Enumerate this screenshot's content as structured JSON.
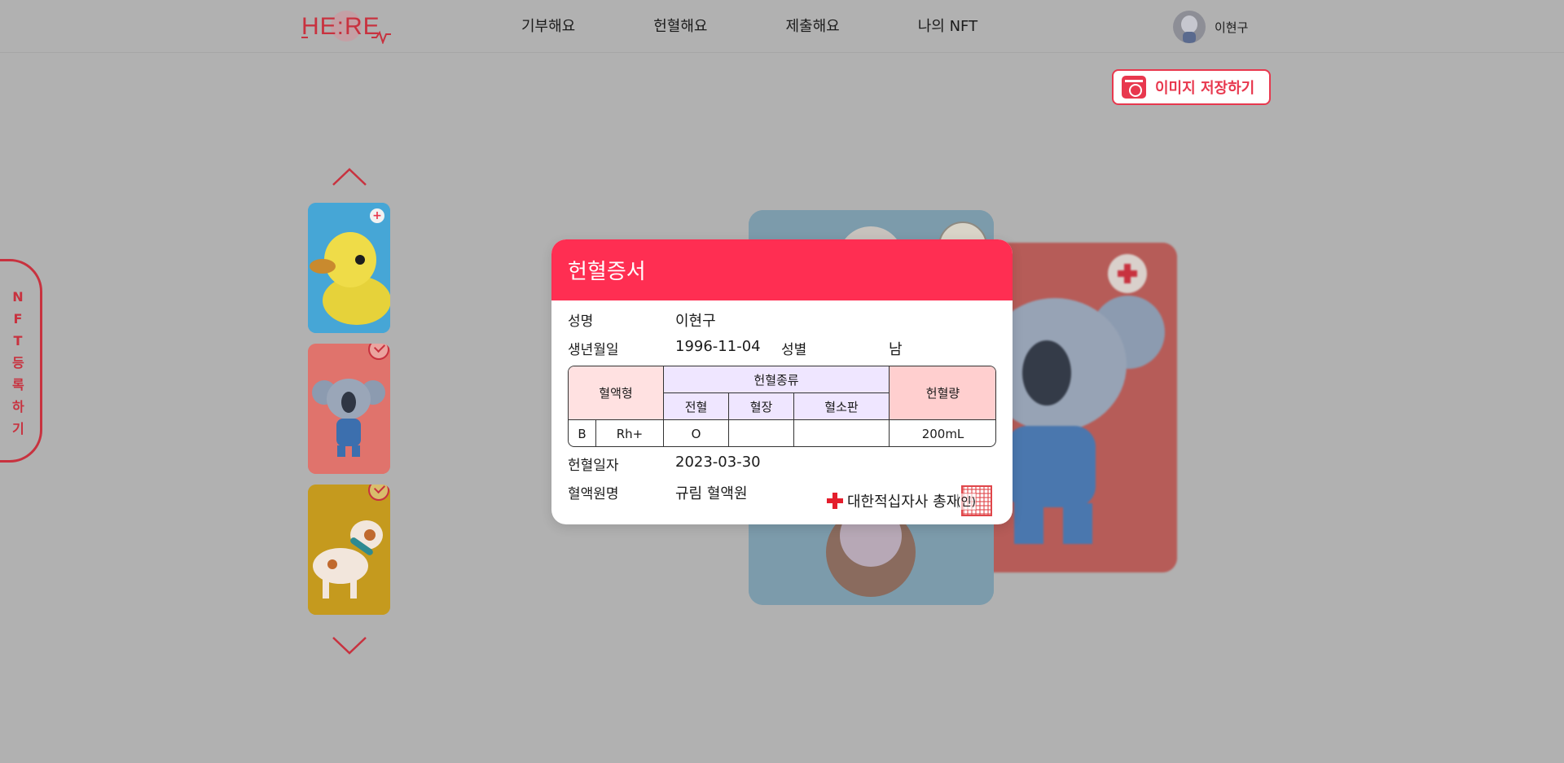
{
  "header": {
    "logo_text": "HE:RE",
    "nav": [
      "기부해요",
      "헌혈해요",
      "제출해요",
      "나의 NFT"
    ],
    "user_name": "이현구"
  },
  "actions": {
    "save_image_label": "이미지 저장하기"
  },
  "side_tab": {
    "label": "NFT등록하기"
  },
  "carousel": {
    "items": [
      {
        "name": "duck",
        "color": "#46a6d6",
        "selected": false
      },
      {
        "name": "koala",
        "color": "#e0736c",
        "selected": true
      },
      {
        "name": "dog",
        "color": "#c59a1e",
        "selected": true
      }
    ]
  },
  "certificate": {
    "title": "헌혈증서",
    "name_label": "성명",
    "name_value": "이현구",
    "birth_label": "생년월일",
    "birth_value": "1996-11-04",
    "gender_label": "성별",
    "gender_value": "남",
    "table": {
      "blood_type_header": "혈액형",
      "donation_kind_header": "헌혈종류",
      "volume_header": "헌혈량",
      "kinds": [
        "전혈",
        "혈장",
        "혈소판"
      ],
      "blood_abo": "B",
      "blood_rh": "Rh+",
      "whole_blood_mark": "O",
      "plasma_mark": "",
      "platelet_mark": "",
      "volume_value": "200mL"
    },
    "date_label": "헌혈일자",
    "date_value": "2023-03-30",
    "center_label": "혈액원명",
    "center_value": "규림 혈액원",
    "issuer": "대한적십자사 총재",
    "seal_text": "(인)"
  }
}
